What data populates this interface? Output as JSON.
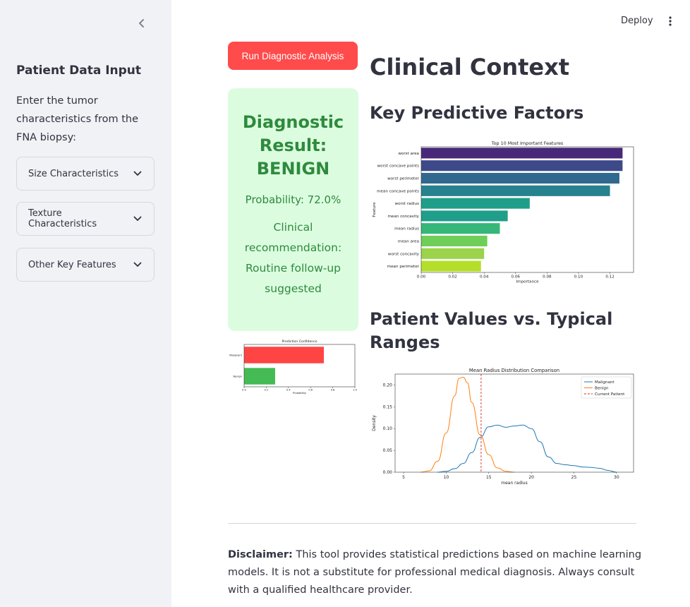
{
  "header": {
    "deploy_label": "Deploy"
  },
  "sidebar": {
    "title": "Patient Data Input",
    "description": "Enter the tumor characteristics from the FNA biopsy:",
    "expanders": [
      {
        "label": "Size Characteristics"
      },
      {
        "label": "Texture Characteristics"
      },
      {
        "label": "Other Key Features"
      }
    ]
  },
  "main": {
    "run_button": "Run Diagnostic Analysis",
    "result": {
      "title": "Diagnostic Result: BENIGN",
      "probability": "Probability: 72.0%",
      "recommendation": "Clinical recommendation: Routine follow-up suggested"
    },
    "heading": "Clinical Context",
    "subheading_factors": "Key Predictive Factors",
    "subheading_ranges": "Patient Values vs. Typical Ranges",
    "disclaimer_label": "Disclaimer:",
    "disclaimer_text": " This tool provides statistical predictions based on machine learning models. It is not a substitute for professional medical diagnosis. Always consult with a qualified healthcare provider."
  },
  "colors": {
    "accent": "#ff4b4b",
    "result_bg": "#dcfce0",
    "result_text": "#2e8b3d"
  },
  "chart_data": [
    {
      "type": "bar",
      "orientation": "horizontal",
      "title": "Prediction Confidence",
      "xlabel": "Probability",
      "categories": [
        "Malignant",
        "Benign"
      ],
      "values": [
        0.72,
        0.28
      ],
      "colors": [
        "#ff4444",
        "#44bb55"
      ],
      "xlim": [
        0,
        1.0
      ],
      "xticks": [
        "0.0",
        "0.2",
        "0.4",
        "0.6",
        "0.8",
        "1.0"
      ]
    },
    {
      "type": "bar",
      "orientation": "horizontal",
      "title": "Top 10 Most Important Features",
      "xlabel": "Importance",
      "ylabel": "Feature",
      "categories": [
        "worst area",
        "worst concave points",
        "worst perimeter",
        "mean concave points",
        "worst radius",
        "mean concavity",
        "mean radius",
        "mean area",
        "worst concavity",
        "mean perimeter"
      ],
      "values": [
        0.128,
        0.128,
        0.126,
        0.12,
        0.069,
        0.055,
        0.05,
        0.042,
        0.04,
        0.038
      ],
      "colors": [
        "#482878",
        "#3e4989",
        "#31688e",
        "#26828e",
        "#1f9e89",
        "#1f9e89",
        "#35b779",
        "#6ece58",
        "#9bd34a",
        "#b5de2b"
      ],
      "xlim": [
        0,
        0.135
      ],
      "xticks": [
        "0.00",
        "0.02",
        "0.04",
        "0.06",
        "0.08",
        "0.10",
        "0.12"
      ]
    },
    {
      "type": "line",
      "title": "Mean Radius Distribution Comparison",
      "xlabel": "mean radius",
      "ylabel": "Density",
      "xlim": [
        4,
        32
      ],
      "ylim": [
        0,
        0.225
      ],
      "xticks": [
        "5",
        "10",
        "15",
        "20",
        "25",
        "30"
      ],
      "yticks": [
        "0.00",
        "0.05",
        "0.10",
        "0.15",
        "0.20"
      ],
      "legend_position": "top-right",
      "series": [
        {
          "name": "Malignant",
          "color": "#1f77b4",
          "x": [
            9,
            10,
            11,
            12,
            13,
            14,
            15,
            16,
            17,
            18,
            19,
            20,
            21,
            22,
            23,
            24,
            25,
            26,
            27,
            28,
            29,
            30
          ],
          "y": [
            0.0,
            0.002,
            0.008,
            0.02,
            0.045,
            0.08,
            0.104,
            0.108,
            0.103,
            0.106,
            0.108,
            0.1,
            0.07,
            0.035,
            0.02,
            0.017,
            0.015,
            0.012,
            0.011,
            0.009,
            0.004,
            0.0
          ]
        },
        {
          "name": "Benign",
          "color": "#ff7f0e",
          "x": [
            7,
            8,
            9,
            10,
            11,
            11.5,
            12,
            12.5,
            13,
            14,
            15,
            16,
            17,
            18
          ],
          "y": [
            0.0,
            0.003,
            0.025,
            0.09,
            0.175,
            0.215,
            0.218,
            0.205,
            0.16,
            0.085,
            0.04,
            0.01,
            0.002,
            0.0
          ]
        }
      ],
      "vlines": [
        {
          "name": "Current Patient",
          "x": 14.1,
          "color": "#d62728",
          "style": "dashed"
        }
      ]
    }
  ]
}
